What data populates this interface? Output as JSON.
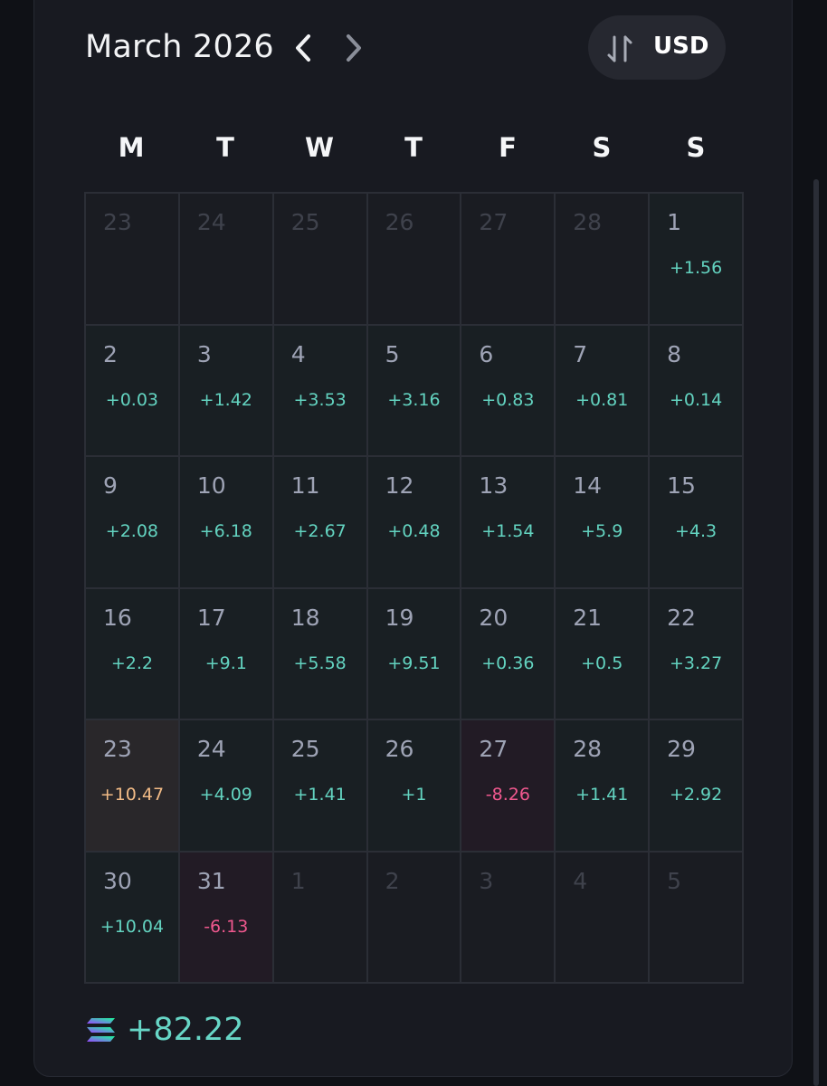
{
  "header": {
    "month_title": "March 2026",
    "currency": "USD"
  },
  "weekdays": [
    "M",
    "T",
    "W",
    "T",
    "F",
    "S",
    "S"
  ],
  "calendar": {
    "cells": [
      {
        "day": "23",
        "pnl": "",
        "state": "muted"
      },
      {
        "day": "24",
        "pnl": "",
        "state": "muted"
      },
      {
        "day": "25",
        "pnl": "",
        "state": "muted"
      },
      {
        "day": "26",
        "pnl": "",
        "state": "muted"
      },
      {
        "day": "27",
        "pnl": "",
        "state": "muted"
      },
      {
        "day": "28",
        "pnl": "",
        "state": "muted"
      },
      {
        "day": "1",
        "pnl": "+1.56",
        "state": "gain"
      },
      {
        "day": "2",
        "pnl": "+0.03",
        "state": "gain"
      },
      {
        "day": "3",
        "pnl": "+1.42",
        "state": "gain"
      },
      {
        "day": "4",
        "pnl": "+3.53",
        "state": "gain"
      },
      {
        "day": "5",
        "pnl": "+3.16",
        "state": "gain"
      },
      {
        "day": "6",
        "pnl": "+0.83",
        "state": "gain"
      },
      {
        "day": "7",
        "pnl": "+0.81",
        "state": "gain"
      },
      {
        "day": "8",
        "pnl": "+0.14",
        "state": "gain"
      },
      {
        "day": "9",
        "pnl": "+2.08",
        "state": "gain"
      },
      {
        "day": "10",
        "pnl": "+6.18",
        "state": "gain"
      },
      {
        "day": "11",
        "pnl": "+2.67",
        "state": "gain"
      },
      {
        "day": "12",
        "pnl": "+0.48",
        "state": "gain"
      },
      {
        "day": "13",
        "pnl": "+1.54",
        "state": "gain"
      },
      {
        "day": "14",
        "pnl": "+5.9",
        "state": "gain"
      },
      {
        "day": "15",
        "pnl": "+4.3",
        "state": "gain"
      },
      {
        "day": "16",
        "pnl": "+2.2",
        "state": "gain"
      },
      {
        "day": "17",
        "pnl": "+9.1",
        "state": "gain"
      },
      {
        "day": "18",
        "pnl": "+5.58",
        "state": "gain"
      },
      {
        "day": "19",
        "pnl": "+9.51",
        "state": "gain"
      },
      {
        "day": "20",
        "pnl": "+0.36",
        "state": "gain"
      },
      {
        "day": "21",
        "pnl": "+0.5",
        "state": "gain"
      },
      {
        "day": "22",
        "pnl": "+3.27",
        "state": "gain"
      },
      {
        "day": "23",
        "pnl": "+10.47",
        "state": "peak"
      },
      {
        "day": "24",
        "pnl": "+4.09",
        "state": "gain"
      },
      {
        "day": "25",
        "pnl": "+1.41",
        "state": "gain"
      },
      {
        "day": "26",
        "pnl": "+1",
        "state": "gain"
      },
      {
        "day": "27",
        "pnl": "-8.26",
        "state": "loss"
      },
      {
        "day": "28",
        "pnl": "+1.41",
        "state": "gain"
      },
      {
        "day": "29",
        "pnl": "+2.92",
        "state": "gain"
      },
      {
        "day": "30",
        "pnl": "+10.04",
        "state": "gain"
      },
      {
        "day": "31",
        "pnl": "-6.13",
        "state": "loss"
      },
      {
        "day": "1",
        "pnl": "",
        "state": "muted"
      },
      {
        "day": "2",
        "pnl": "",
        "state": "muted"
      },
      {
        "day": "3",
        "pnl": "",
        "state": "muted"
      },
      {
        "day": "4",
        "pnl": "",
        "state": "muted"
      },
      {
        "day": "5",
        "pnl": "",
        "state": "muted"
      }
    ]
  },
  "total": {
    "icon": "solana-icon",
    "value": "+82.22"
  },
  "colors": {
    "gain": "#63d3c0",
    "loss": "#f0588e",
    "peak": "#f2bb86",
    "background": "#181a21"
  }
}
